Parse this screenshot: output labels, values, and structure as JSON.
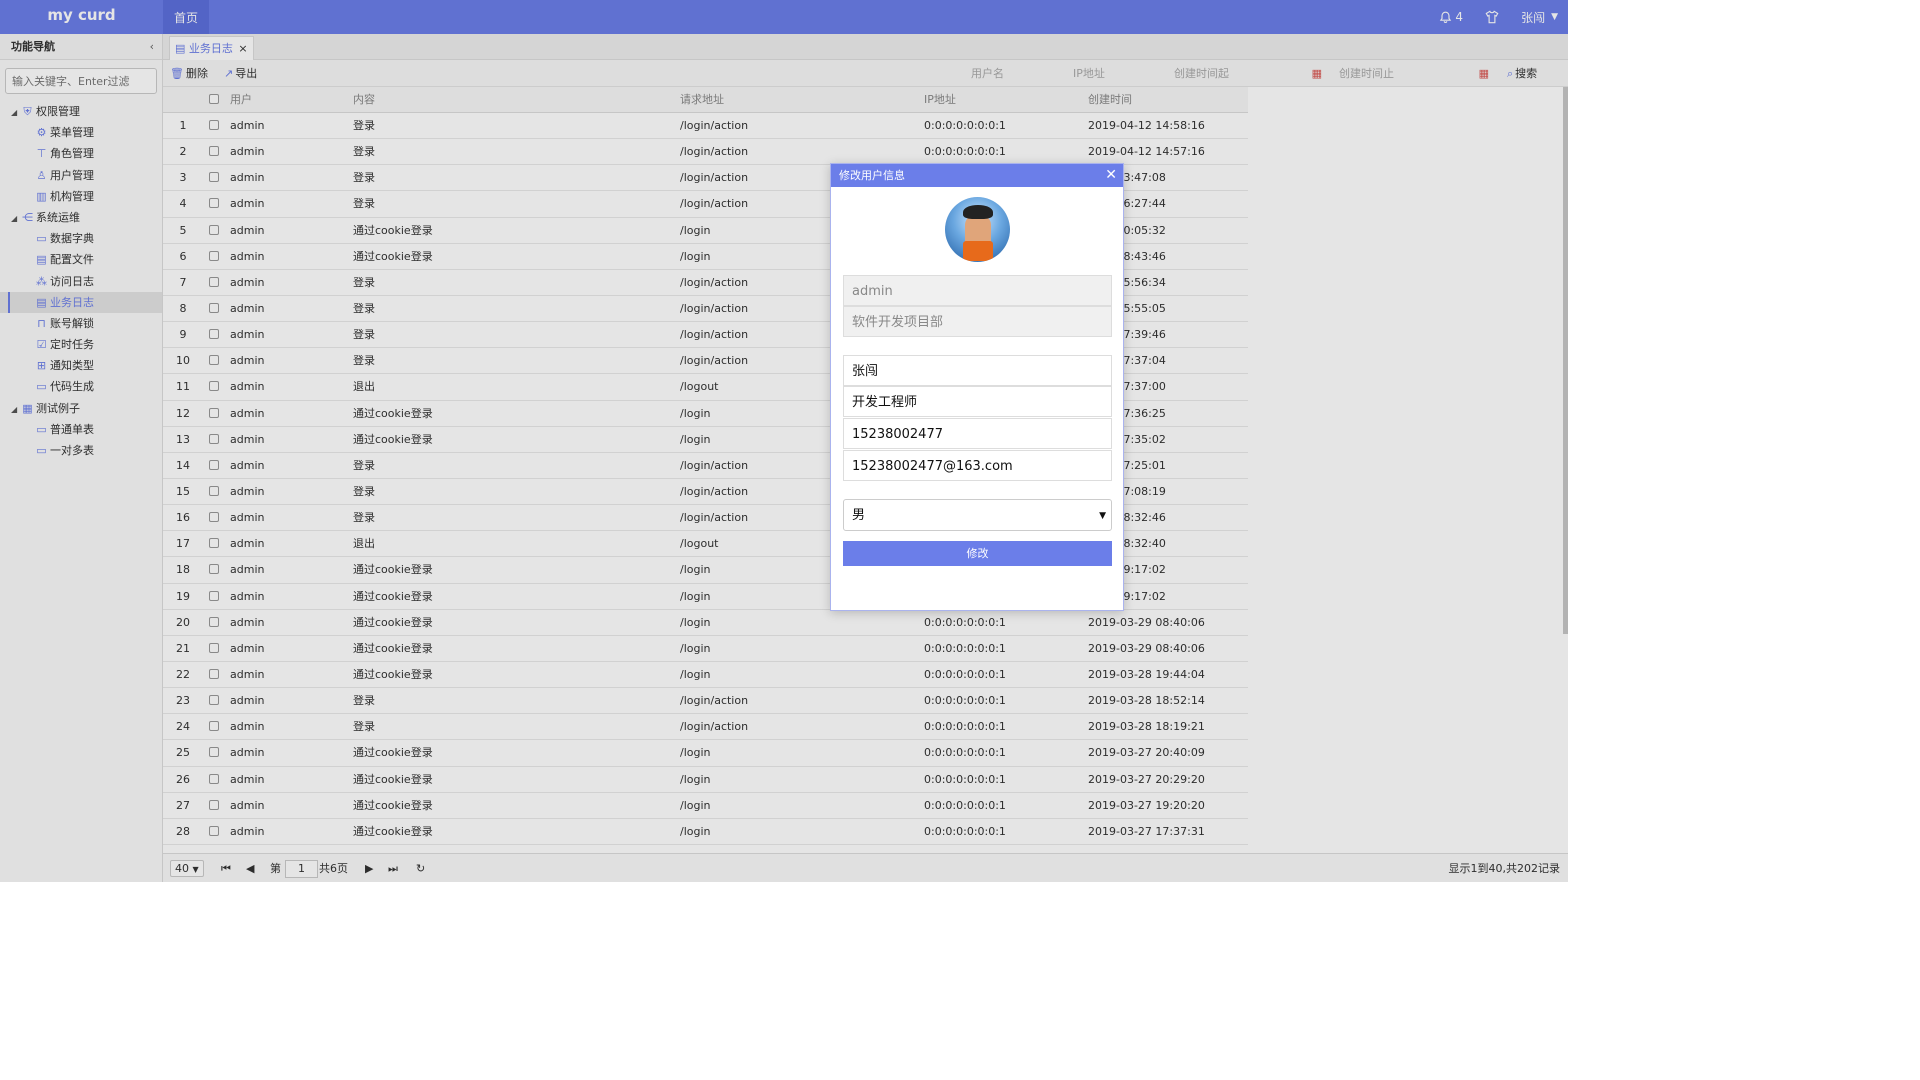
{
  "app": {
    "logo": "my curd",
    "home_tab": "首页",
    "notif_count": "4",
    "user_name": "张闯"
  },
  "sidebar": {
    "title": "功能导航",
    "collapse_glyph": "‹",
    "search_placeholder": "输入关键字、Enter过滤",
    "groups": [
      {
        "label": "权限管理",
        "icon": "shield-icon",
        "items": [
          "菜单管理",
          "角色管理",
          "用户管理",
          "机构管理"
        ]
      },
      {
        "label": "系统运维",
        "icon": "share-icon",
        "items": [
          "数据字典",
          "配置文件",
          "访问日志",
          "业务日志",
          "账号解锁",
          "定时任务",
          "通知类型",
          "代码生成"
        ]
      },
      {
        "label": "测试例子",
        "icon": "table-icon",
        "items": [
          "普通单表",
          "一对多表"
        ]
      }
    ],
    "selected": "业务日志"
  },
  "tabs": [
    {
      "label": "业务日志",
      "close": "×"
    }
  ],
  "toolbar": {
    "delete_label": "删除",
    "export_label": "导出",
    "user_placeholder": "用户名",
    "ip_placeholder": "IP地址",
    "start_placeholder": "创建时间起",
    "end_placeholder": "创建时间止",
    "search_label": "搜索"
  },
  "table": {
    "headers": {
      "user": "用户",
      "content": "内容",
      "url": "请求地址",
      "ip": "IP地址",
      "time": "创建时间"
    },
    "rows": [
      {
        "n": "1",
        "user": "admin",
        "content": "登录",
        "url": "/login/action",
        "ip": "0:0:0:0:0:0:0:1",
        "time": "2019-04-12 14:58:16"
      },
      {
        "n": "2",
        "user": "admin",
        "content": "登录",
        "url": "/login/action",
        "ip": "0:0:0:0:0:0:0:1",
        "time": "2019-04-12 14:57:16"
      },
      {
        "n": "3",
        "user": "admin",
        "content": "登录",
        "url": "/login/action",
        "ip": "",
        "time": "4-12 13:47:08"
      },
      {
        "n": "4",
        "user": "admin",
        "content": "登录",
        "url": "/login/action",
        "ip": "",
        "time": "4-11 16:27:44"
      },
      {
        "n": "5",
        "user": "admin",
        "content": "通过cookie登录",
        "url": "/login",
        "ip": "",
        "time": "4-11 10:05:32"
      },
      {
        "n": "6",
        "user": "admin",
        "content": "通过cookie登录",
        "url": "/login",
        "ip": "",
        "time": "4-11 08:43:46"
      },
      {
        "n": "7",
        "user": "admin",
        "content": "登录",
        "url": "/login/action",
        "ip": "",
        "time": "4-10 15:56:34"
      },
      {
        "n": "8",
        "user": "admin",
        "content": "登录",
        "url": "/login/action",
        "ip": "",
        "time": "4-10 15:55:05"
      },
      {
        "n": "9",
        "user": "admin",
        "content": "登录",
        "url": "/login/action",
        "ip": "",
        "time": "4-09 17:39:46"
      },
      {
        "n": "10",
        "user": "admin",
        "content": "登录",
        "url": "/login/action",
        "ip": "",
        "time": "4-09 17:37:04"
      },
      {
        "n": "11",
        "user": "admin",
        "content": "退出",
        "url": "/logout",
        "ip": "",
        "time": "4-09 17:37:00"
      },
      {
        "n": "12",
        "user": "admin",
        "content": "通过cookie登录",
        "url": "/login",
        "ip": "",
        "time": "4-09 17:36:25"
      },
      {
        "n": "13",
        "user": "admin",
        "content": "通过cookie登录",
        "url": "/login",
        "ip": "",
        "time": "4-09 17:35:02"
      },
      {
        "n": "14",
        "user": "admin",
        "content": "登录",
        "url": "/login/action",
        "ip": "",
        "time": "4-09 17:25:01"
      },
      {
        "n": "15",
        "user": "admin",
        "content": "登录",
        "url": "/login/action",
        "ip": "",
        "time": "4-09 17:08:19"
      },
      {
        "n": "16",
        "user": "admin",
        "content": "登录",
        "url": "/login/action",
        "ip": "",
        "time": "4-08 18:32:46"
      },
      {
        "n": "17",
        "user": "admin",
        "content": "退出",
        "url": "/logout",
        "ip": "",
        "time": "4-08 18:32:40"
      },
      {
        "n": "18",
        "user": "admin",
        "content": "通过cookie登录",
        "url": "/login",
        "ip": "",
        "time": "3-29 09:17:02"
      },
      {
        "n": "19",
        "user": "admin",
        "content": "通过cookie登录",
        "url": "/login",
        "ip": "",
        "time": "3-29 09:17:02"
      },
      {
        "n": "20",
        "user": "admin",
        "content": "通过cookie登录",
        "url": "/login",
        "ip": "0:0:0:0:0:0:0:1",
        "time": "2019-03-29 08:40:06"
      },
      {
        "n": "21",
        "user": "admin",
        "content": "通过cookie登录",
        "url": "/login",
        "ip": "0:0:0:0:0:0:0:1",
        "time": "2019-03-29 08:40:06"
      },
      {
        "n": "22",
        "user": "admin",
        "content": "通过cookie登录",
        "url": "/login",
        "ip": "0:0:0:0:0:0:0:1",
        "time": "2019-03-28 19:44:04"
      },
      {
        "n": "23",
        "user": "admin",
        "content": "登录",
        "url": "/login/action",
        "ip": "0:0:0:0:0:0:0:1",
        "time": "2019-03-28 18:52:14"
      },
      {
        "n": "24",
        "user": "admin",
        "content": "登录",
        "url": "/login/action",
        "ip": "0:0:0:0:0:0:0:1",
        "time": "2019-03-28 18:19:21"
      },
      {
        "n": "25",
        "user": "admin",
        "content": "通过cookie登录",
        "url": "/login",
        "ip": "0:0:0:0:0:0:0:1",
        "time": "2019-03-27 20:40:09"
      },
      {
        "n": "26",
        "user": "admin",
        "content": "通过cookie登录",
        "url": "/login",
        "ip": "0:0:0:0:0:0:0:1",
        "time": "2019-03-27 20:29:20"
      },
      {
        "n": "27",
        "user": "admin",
        "content": "通过cookie登录",
        "url": "/login",
        "ip": "0:0:0:0:0:0:0:1",
        "time": "2019-03-27 19:20:20"
      },
      {
        "n": "28",
        "user": "admin",
        "content": "通过cookie登录",
        "url": "/login",
        "ip": "0:0:0:0:0:0:0:1",
        "time": "2019-03-27 17:37:31"
      }
    ]
  },
  "pager": {
    "page_size": "40",
    "page_prefix": "第",
    "page": "1",
    "page_total": "共6页",
    "summary": "显示1到40,共202记录"
  },
  "dialog": {
    "title": "修改用户信息",
    "username": "admin",
    "org": "软件开发项目部",
    "name": "张闯",
    "position": "开发工程师",
    "phone": "15238002477",
    "email": "15238002477@163.com",
    "gender": "男",
    "submit_label": "修改"
  },
  "colors": {
    "accent": "#6b7ee9",
    "calendar": "#d9534f"
  }
}
